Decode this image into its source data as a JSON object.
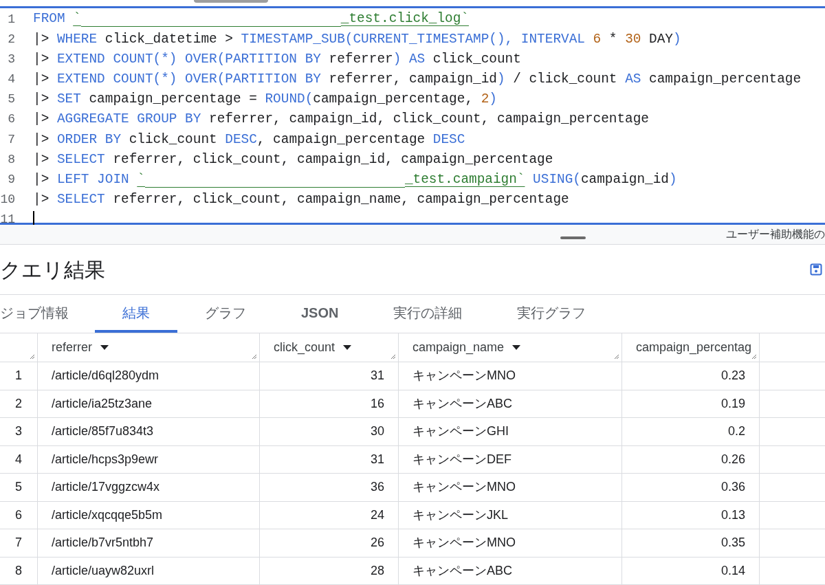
{
  "editor": {
    "lines": [
      {
        "number": "1",
        "tokens": [
          {
            "kind": "keyword",
            "text": "FROM "
          },
          {
            "kind": "string",
            "text": "`"
          },
          {
            "kind": "redacted"
          },
          {
            "kind": "string",
            "text": "_test.click_log`"
          }
        ]
      },
      {
        "number": "2",
        "tokens": [
          {
            "kind": "plain",
            "text": "|> "
          },
          {
            "kind": "keyword",
            "text": "WHERE "
          },
          {
            "kind": "plain",
            "text": "click_datetime > "
          },
          {
            "kind": "keyword",
            "text": "TIMESTAMP_SUB(CURRENT_TIMESTAMP(), INTERVAL "
          },
          {
            "kind": "number",
            "text": "6"
          },
          {
            "kind": "plain",
            "text": " * "
          },
          {
            "kind": "number",
            "text": "30"
          },
          {
            "kind": "plain",
            "text": " DAY"
          },
          {
            "kind": "keyword",
            "text": ")"
          }
        ]
      },
      {
        "number": "3",
        "tokens": [
          {
            "kind": "plain",
            "text": "|> "
          },
          {
            "kind": "keyword",
            "text": "EXTEND COUNT(*) OVER(PARTITION BY "
          },
          {
            "kind": "plain",
            "text": "referrer"
          },
          {
            "kind": "keyword",
            "text": ") AS "
          },
          {
            "kind": "plain",
            "text": "click_count"
          }
        ]
      },
      {
        "number": "4",
        "tokens": [
          {
            "kind": "plain",
            "text": "|> "
          },
          {
            "kind": "keyword",
            "text": "EXTEND COUNT(*) OVER(PARTITION BY "
          },
          {
            "kind": "plain",
            "text": "referrer, campaign_id"
          },
          {
            "kind": "keyword",
            "text": ")"
          },
          {
            "kind": "plain",
            "text": " / click_count "
          },
          {
            "kind": "keyword",
            "text": "AS "
          },
          {
            "kind": "plain",
            "text": "campaign_percentage"
          }
        ]
      },
      {
        "number": "5",
        "tokens": [
          {
            "kind": "plain",
            "text": "|> "
          },
          {
            "kind": "keyword",
            "text": "SET "
          },
          {
            "kind": "plain",
            "text": "campaign_percentage = "
          },
          {
            "kind": "keyword",
            "text": "ROUND("
          },
          {
            "kind": "plain",
            "text": "campaign_percentage, "
          },
          {
            "kind": "number",
            "text": "2"
          },
          {
            "kind": "keyword",
            "text": ")"
          }
        ]
      },
      {
        "number": "6",
        "tokens": [
          {
            "kind": "plain",
            "text": "|> "
          },
          {
            "kind": "keyword",
            "text": "AGGREGATE GROUP BY "
          },
          {
            "kind": "plain",
            "text": "referrer, campaign_id, click_count, campaign_percentage"
          }
        ]
      },
      {
        "number": "7",
        "tokens": [
          {
            "kind": "plain",
            "text": "|> "
          },
          {
            "kind": "keyword",
            "text": "ORDER BY "
          },
          {
            "kind": "plain",
            "text": "click_count "
          },
          {
            "kind": "keyword",
            "text": "DESC"
          },
          {
            "kind": "plain",
            "text": ", campaign_percentage "
          },
          {
            "kind": "keyword",
            "text": "DESC"
          }
        ]
      },
      {
        "number": "8",
        "tokens": [
          {
            "kind": "plain",
            "text": "|> "
          },
          {
            "kind": "keyword",
            "text": "SELECT "
          },
          {
            "kind": "plain",
            "text": "referrer, click_count, campaign_id, campaign_percentage"
          }
        ]
      },
      {
        "number": "9",
        "tokens": [
          {
            "kind": "plain",
            "text": "|> "
          },
          {
            "kind": "keyword",
            "text": "LEFT JOIN "
          },
          {
            "kind": "string",
            "text": "`"
          },
          {
            "kind": "redacted"
          },
          {
            "kind": "string",
            "text": "_test.campaign`"
          },
          {
            "kind": "keyword",
            "text": " USING("
          },
          {
            "kind": "plain",
            "text": "campaign_id"
          },
          {
            "kind": "keyword",
            "text": ")"
          }
        ]
      },
      {
        "number": "10",
        "tokens": [
          {
            "kind": "plain",
            "text": "|> "
          },
          {
            "kind": "keyword",
            "text": "SELECT "
          },
          {
            "kind": "plain",
            "text": "referrer, click_count, campaign_name, campaign_percentage"
          }
        ]
      },
      {
        "number": "11",
        "cursor": true
      }
    ]
  },
  "accessibility_hint": "ユーザー補助機能の",
  "results": {
    "title": "クエリ結果",
    "tabs": [
      {
        "label": "ジョブ情報",
        "selected": false
      },
      {
        "label": "結果",
        "selected": true
      },
      {
        "label": "グラフ",
        "selected": false
      },
      {
        "label": "JSON",
        "selected": false
      },
      {
        "label": "実行の詳細",
        "selected": false
      },
      {
        "label": "実行グラフ",
        "selected": false
      }
    ],
    "table": {
      "columns": [
        "",
        "referrer",
        "click_count",
        "campaign_name",
        "campaign_percentag"
      ],
      "rows": [
        [
          "1",
          "/article/d6ql280ydm",
          "31",
          "キャンペーンMNO",
          "0.23"
        ],
        [
          "2",
          "/article/ia25tz3ane",
          "16",
          "キャンペーンABC",
          "0.19"
        ],
        [
          "3",
          "/article/85f7u834t3",
          "30",
          "キャンペーンGHI",
          "0.2"
        ],
        [
          "4",
          "/article/hcps3p9ewr",
          "31",
          "キャンペーンDEF",
          "0.26"
        ],
        [
          "5",
          "/article/17vggzcw4x",
          "36",
          "キャンペーンMNO",
          "0.36"
        ],
        [
          "6",
          "/article/xqcqqe5b5m",
          "24",
          "キャンペーンJKL",
          "0.13"
        ],
        [
          "7",
          "/article/b7vr5ntbh7",
          "26",
          "キャンペーンMNO",
          "0.35"
        ],
        [
          "8",
          "/article/uayw82uxrl",
          "28",
          "キャンペーンABC",
          "0.14"
        ]
      ]
    }
  }
}
